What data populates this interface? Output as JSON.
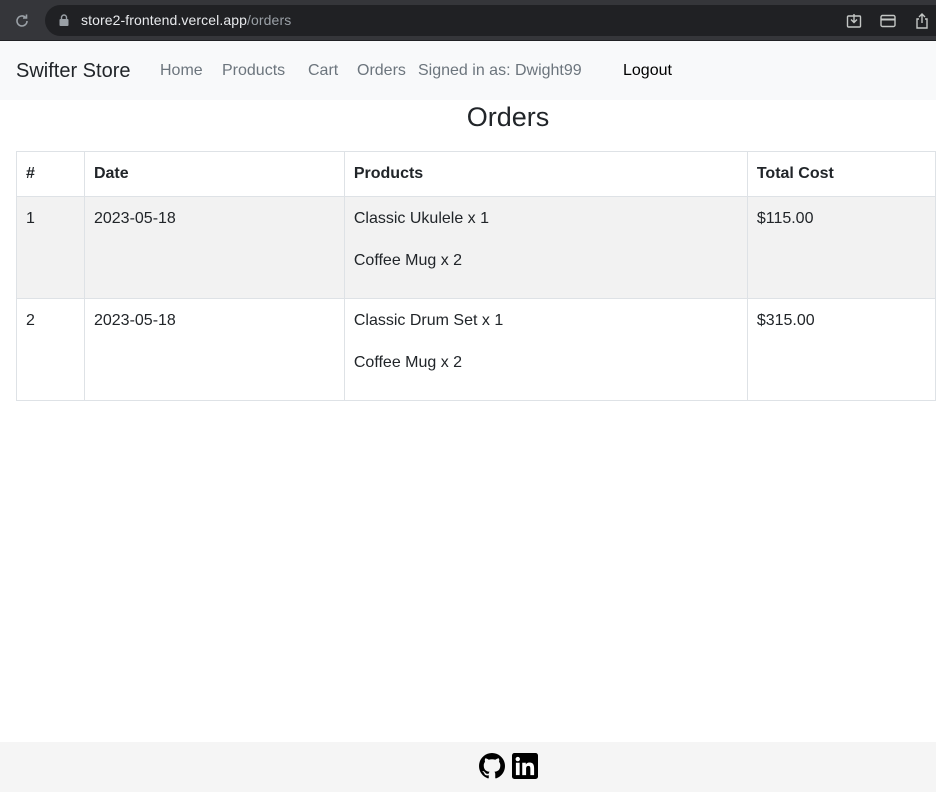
{
  "browser": {
    "url_host": "store2-frontend.vercel.app",
    "url_path": "/orders"
  },
  "navbar": {
    "brand": "Swifter Store",
    "links": [
      "Home",
      "Products",
      "Cart",
      "Orders"
    ],
    "signed_in": "Signed in as: Dwight99",
    "logout": "Logout"
  },
  "page": {
    "title": "Orders"
  },
  "table": {
    "headers": [
      "#",
      "Date",
      "Products",
      "Total Cost"
    ],
    "rows": [
      {
        "num": "1",
        "date": "2023-05-18",
        "products": [
          "Classic Ukulele x 1",
          "Coffee Mug x 2"
        ],
        "total": "$115.00"
      },
      {
        "num": "2",
        "date": "2023-05-18",
        "products": [
          "Classic Drum Set x 1",
          "Coffee Mug x 2"
        ],
        "total": "$315.00"
      }
    ]
  },
  "footer": {
    "icons": [
      "github-icon",
      "linkedin-icon"
    ]
  },
  "colors": {
    "navbar_bg": "#f8f9fa",
    "nav_link": "#6c757d",
    "stripe": "#f2f2f2",
    "footer_bg": "#f5f5f5"
  }
}
